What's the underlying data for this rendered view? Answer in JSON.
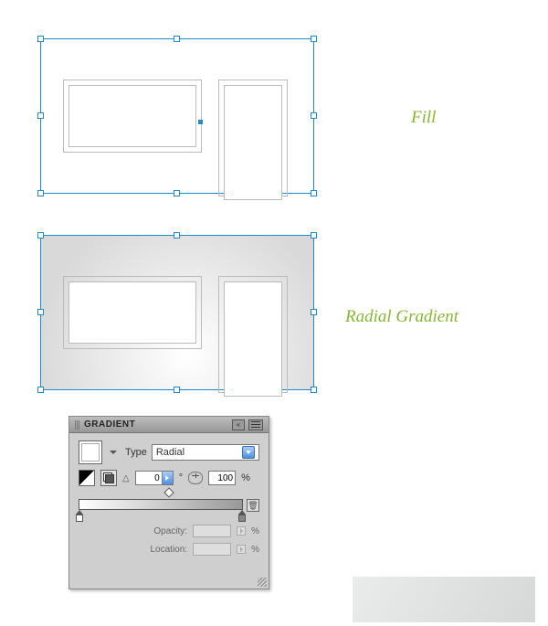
{
  "labels": {
    "fill": "Fill",
    "radial_gradient": "Radial Gradient"
  },
  "gradient_panel": {
    "title": "GRADIENT",
    "type_label": "Type",
    "type_value": "Radial",
    "angle_value": "0",
    "aspect_value": "100",
    "aspect_unit": "%",
    "opacity_label": "Opacity:",
    "opacity_unit": "%",
    "location_label": "Location:",
    "location_unit": "%",
    "angle_symbol": "°"
  },
  "icons": {
    "collapse": "collapse-icon",
    "panel_menu": "panel-menu-icon",
    "reverse_gradient": "reverse-gradient-icon",
    "swap_fill_stroke": "swap-fill-stroke-icon",
    "aspect_ratio": "aspect-ratio-icon",
    "trash": "trash-icon"
  }
}
